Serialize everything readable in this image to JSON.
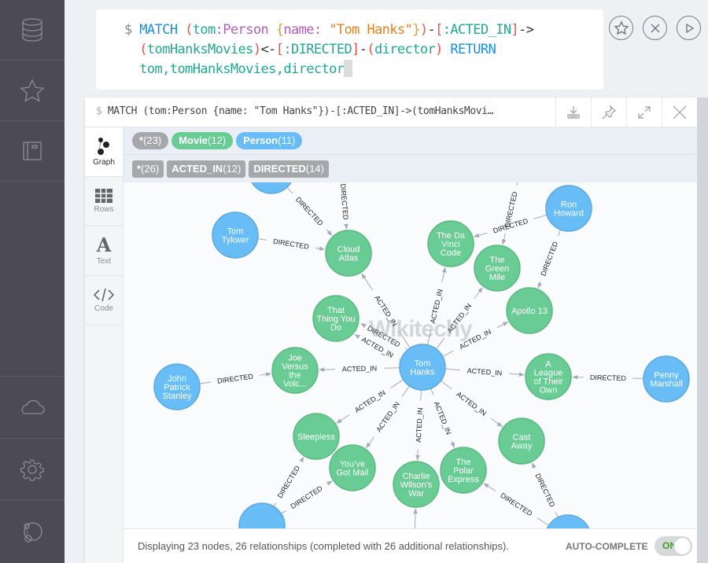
{
  "nav": {
    "items": [
      {
        "icon": "database-icon",
        "label": "Database"
      },
      {
        "icon": "star-icon",
        "label": "Favorites"
      },
      {
        "icon": "book-icon",
        "label": "Documents"
      },
      {
        "icon": "cloud-icon",
        "label": "Cloud"
      },
      {
        "icon": "gear-icon",
        "label": "Settings"
      },
      {
        "icon": "neo4j-icon",
        "label": "About"
      }
    ]
  },
  "editor": {
    "prompt": "$",
    "lines": [
      "MATCH (tom:Person {name: \"Tom Hanks\"})-[:ACTED_IN]->",
      "(tomHanksMovies)<-[:DIRECTED]-(director) RETURN",
      "tom,tomHanksMovies,director"
    ],
    "actions": [
      "favorite",
      "clear",
      "run"
    ]
  },
  "frame": {
    "query": "MATCH (tom:Person {name: \"Tom Hanks\"})-[:ACTED_IN]->(tomHanksMovi…",
    "prompt": "$",
    "tools": [
      "download",
      "pin",
      "expand",
      "close"
    ],
    "tabs": [
      {
        "label": "Graph",
        "active": true
      },
      {
        "label": "Rows",
        "active": false
      },
      {
        "label": "Text",
        "active": false
      },
      {
        "label": "Code",
        "active": false
      }
    ],
    "labels": [
      {
        "name": "*",
        "count": "(23)",
        "color": "#a5a7ab"
      },
      {
        "name": "Movie",
        "count": "(12)",
        "color": "#68cc94"
      },
      {
        "name": "Person",
        "count": "(11)",
        "color": "#68bdf6"
      }
    ],
    "rel_types": [
      {
        "name": "*",
        "count": "(26)"
      },
      {
        "name": "ACTED_IN",
        "count": "(12)"
      },
      {
        "name": "DIRECTED",
        "count": "(14)"
      }
    ],
    "status": "Displaying 23 nodes, 26 relationships (completed with 26 additional relationships).",
    "autocomplete_label": "AUTO-COMPLETE",
    "autocomplete_state": "ON",
    "watermark": "Wikitechy"
  },
  "graph": {
    "colors": {
      "person": "#68bdf6",
      "person_stroke": "#5ca8db",
      "movie": "#68cc94",
      "movie_stroke": "#5db882",
      "edge": "#a5abb6"
    },
    "nodes": [
      {
        "id": "tom",
        "type": "person",
        "lines": [
          "Tom",
          "Hanks"
        ]
      },
      {
        "id": "tykwer",
        "type": "person",
        "lines": [
          "Tom",
          "Tykwer"
        ]
      },
      {
        "id": "ron",
        "type": "person",
        "lines": [
          "Ron",
          "Howard"
        ]
      },
      {
        "id": "john",
        "type": "person",
        "lines": [
          "John",
          "Patrick",
          "Stanley"
        ]
      },
      {
        "id": "penny",
        "type": "person",
        "lines": [
          "Penny",
          "Marshall"
        ]
      },
      {
        "id": "p_top",
        "type": "person",
        "lines": []
      },
      {
        "id": "p_bl",
        "type": "person",
        "lines": []
      },
      {
        "id": "p_br",
        "type": "person",
        "lines": []
      },
      {
        "id": "cloud",
        "type": "movie",
        "lines": [
          "Cloud",
          "Atlas"
        ]
      },
      {
        "id": "davinci",
        "type": "movie",
        "lines": [
          "The Da",
          "Vinci",
          "Code"
        ]
      },
      {
        "id": "green",
        "type": "movie",
        "lines": [
          "The",
          "Green",
          "Mile"
        ]
      },
      {
        "id": "apollo",
        "type": "movie",
        "lines": [
          "Apollo 13"
        ]
      },
      {
        "id": "thatthing",
        "type": "movie",
        "lines": [
          "That",
          "Thing You",
          "Do"
        ]
      },
      {
        "id": "joe",
        "type": "movie",
        "lines": [
          "Joe",
          "Versus",
          "the",
          "Volc..."
        ]
      },
      {
        "id": "league",
        "type": "movie",
        "lines": [
          "A",
          "League",
          "of Their",
          "Own"
        ]
      },
      {
        "id": "sleepless",
        "type": "movie",
        "lines": [
          "Sleepless"
        ]
      },
      {
        "id": "mail",
        "type": "movie",
        "lines": [
          "You've",
          "Got Mail"
        ]
      },
      {
        "id": "charlie",
        "type": "movie",
        "lines": [
          "Charlie",
          "Wilson's",
          "War"
        ]
      },
      {
        "id": "polar",
        "type": "movie",
        "lines": [
          "The",
          "Polar",
          "Express"
        ]
      },
      {
        "id": "cast",
        "type": "movie",
        "lines": [
          "Cast",
          "Away"
        ]
      }
    ],
    "edges": [
      {
        "from": "tom",
        "to": "cloud",
        "label": "ACTED_IN"
      },
      {
        "from": "tom",
        "to": "davinci",
        "label": "ACTED_IN"
      },
      {
        "from": "tom",
        "to": "green",
        "label": "ACTED_IN"
      },
      {
        "from": "tom",
        "to": "apollo",
        "label": "ACTED_IN"
      },
      {
        "from": "tom",
        "to": "thatthing",
        "label": "ACTED_IN"
      },
      {
        "from": "tom",
        "to": "thatthing",
        "label": "DIRECTED"
      },
      {
        "from": "tom",
        "to": "joe",
        "label": "ACTED_IN"
      },
      {
        "from": "tom",
        "to": "league",
        "label": "ACTED_IN"
      },
      {
        "from": "tom",
        "to": "sleepless",
        "label": "ACTED_IN"
      },
      {
        "from": "tom",
        "to": "mail",
        "label": "ACTED_IN"
      },
      {
        "from": "tom",
        "to": "charlie",
        "label": "ACTED_IN"
      },
      {
        "from": "tom",
        "to": "polar",
        "label": "ACTED_IN"
      },
      {
        "from": "tom",
        "to": "cast",
        "label": "ACTED_IN"
      },
      {
        "from": "tykwer",
        "to": "cloud",
        "label": "DIRECTED"
      },
      {
        "from": "p_top",
        "to": "cloud",
        "label": "DIRECTED"
      },
      {
        "from": "offtop1",
        "to": "cloud",
        "label": "DIRECTED"
      },
      {
        "from": "ron",
        "to": "davinci",
        "label": "DIRECTED"
      },
      {
        "from": "offtop2",
        "to": "green",
        "label": "DIRECTED"
      },
      {
        "from": "ron",
        "to": "apollo",
        "label": "DIRECTED"
      },
      {
        "from": "john",
        "to": "joe",
        "label": "DIRECTED"
      },
      {
        "from": "penny",
        "to": "league",
        "label": "DIRECTED"
      },
      {
        "from": "p_bl",
        "to": "sleepless",
        "label": "DIRECTED"
      },
      {
        "from": "p_bl",
        "to": "mail",
        "label": "DIRECTED"
      },
      {
        "from": "offbot",
        "to": "charlie",
        "label": ""
      },
      {
        "from": "p_br",
        "to": "polar",
        "label": "DIRECTED"
      },
      {
        "from": "p_br",
        "to": "cast",
        "label": "DIRECTED"
      }
    ]
  }
}
